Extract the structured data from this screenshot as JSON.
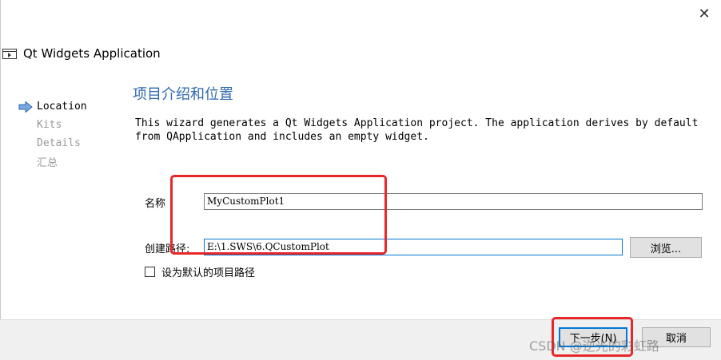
{
  "window": {
    "title": "Qt Widgets Application",
    "close_glyph": "✕"
  },
  "nav": {
    "items": [
      {
        "label": "Location",
        "active": true
      },
      {
        "label": "Kits",
        "active": false
      },
      {
        "label": "Details",
        "active": false
      },
      {
        "label": "汇总",
        "active": false
      }
    ]
  },
  "page": {
    "heading": "项目介绍和位置",
    "description": "This wizard generates a Qt Widgets Application project. The application derives by default\nfrom QApplication and includes an empty widget."
  },
  "form": {
    "name_label": "名称",
    "name_value": "MyCustomPlot1",
    "path_label": "创建路径:",
    "path_value": "E:\\1.SWS\\6.QCustomPlot",
    "browse_label": "浏览...",
    "default_path_label": "设为默认的项目路径",
    "default_path_checked": false
  },
  "footer": {
    "next_label": "下一步(N)",
    "cancel_label": "取消"
  },
  "watermark": {
    "text": "CSDN @逆光的彩虹路"
  },
  "colors": {
    "accent": "#0078d7",
    "heading": "#2f69b0",
    "annotation": "#e8272a"
  }
}
